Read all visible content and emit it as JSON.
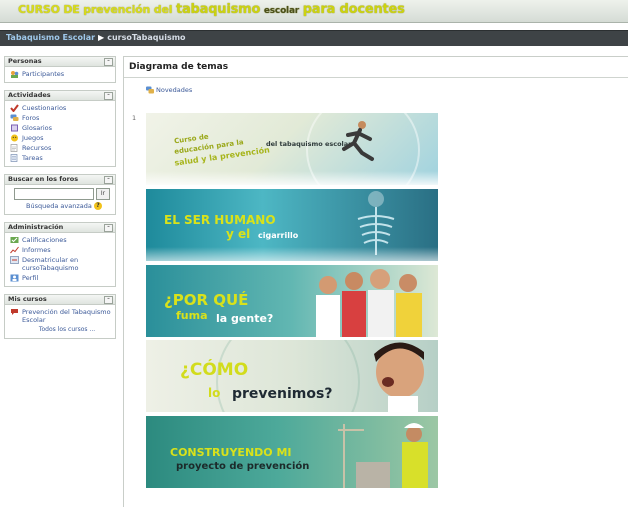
{
  "header": {
    "title_part1": "CURSO DE prevención del",
    "title_part2": "tabaquismo",
    "title_part3": "escolar",
    "title_part4": "para docentes"
  },
  "breadcrumb": {
    "home": "Tabaquismo Escolar",
    "separator": "▶",
    "current": "cursoTabaquismo"
  },
  "blocks": {
    "personas": {
      "title": "Personas",
      "items": [
        {
          "label": "Participantes",
          "icon": "participants-icon"
        }
      ]
    },
    "actividades": {
      "title": "Actividades",
      "items": [
        {
          "label": "Cuestionarios",
          "icon": "quiz-icon"
        },
        {
          "label": "Foros",
          "icon": "forum-icon"
        },
        {
          "label": "Glosarios",
          "icon": "glossary-icon"
        },
        {
          "label": "Juegos",
          "icon": "game-icon"
        },
        {
          "label": "Recursos",
          "icon": "resource-icon"
        },
        {
          "label": "Tareas",
          "icon": "assignment-icon"
        }
      ]
    },
    "buscar": {
      "title": "Buscar en los foros",
      "button": "Ir",
      "advanced": "Búsqueda avanzada",
      "help": "?"
    },
    "administracion": {
      "title": "Administración",
      "items": [
        {
          "label": "Calificaciones",
          "icon": "grades-icon"
        },
        {
          "label": "Informes",
          "icon": "reports-icon"
        },
        {
          "label": "Desmatricular en cursoTabaquismo",
          "icon": "unenrol-icon"
        },
        {
          "label": "Perfil",
          "icon": "profile-icon"
        }
      ]
    },
    "mis_cursos": {
      "title": "Mis cursos",
      "items": [
        {
          "label": "Prevención del Tabaquismo Escolar",
          "icon": "course-icon"
        }
      ],
      "all": "Todos los cursos ..."
    }
  },
  "main": {
    "title": "Diagrama de temas",
    "news": "Novedades",
    "section_number": "1",
    "banners": {
      "b1": {
        "line1": "Curso de",
        "line2": "educación para la",
        "line3": "salud y la prevención",
        "line4": "del tabaquismo escolar"
      },
      "b2": {
        "line1": "EL SER HUMANO",
        "line2": "y el",
        "line3": "cigarrillo"
      },
      "b3": {
        "line1": "¿POR QUÉ",
        "line2": "fuma",
        "line3": "la gente?"
      },
      "b4": {
        "line1": "¿CÓMO",
        "line2": "lo",
        "line3": "prevenimos?"
      },
      "b5": {
        "line1": "CONSTRUYENDO MI",
        "line2": "proyecto de prevención"
      }
    }
  },
  "colors": {
    "header_title": "#d8dc1a",
    "navbar": "#3e4346",
    "link": "#3b5998",
    "crumb_link": "#9fc8ea"
  }
}
